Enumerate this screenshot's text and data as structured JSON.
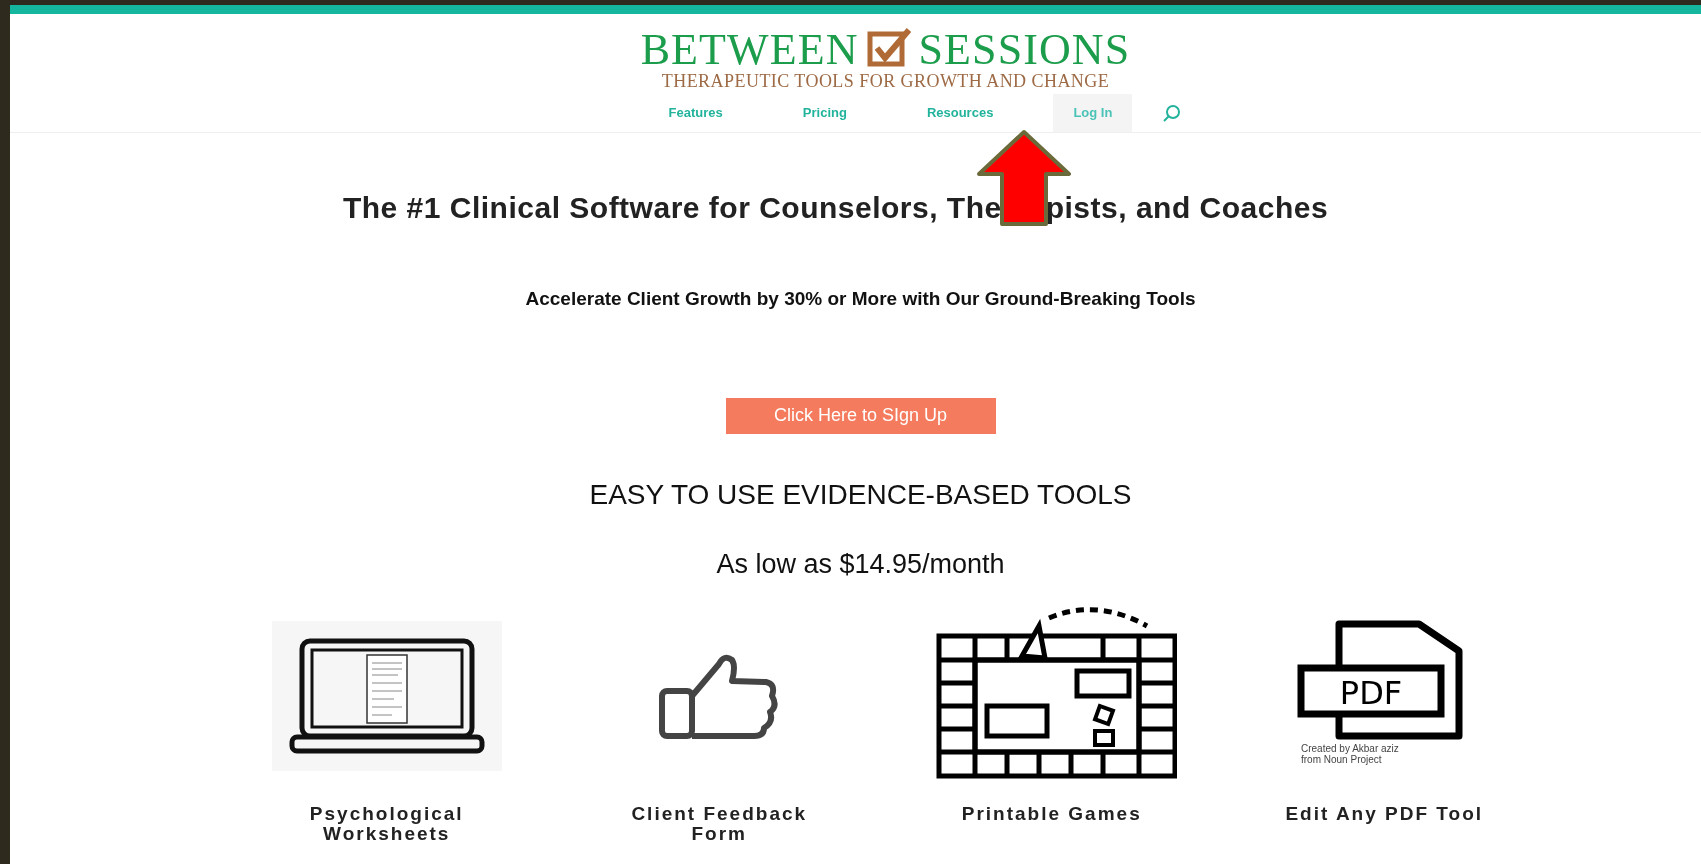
{
  "logo": {
    "left": "BETWEEN",
    "right": "SESSIONS",
    "tagline": "THERAPEUTIC TOOLS FOR GROWTH AND CHANGE"
  },
  "nav": [
    {
      "label": "Features",
      "selected": false
    },
    {
      "label": "Pricing",
      "selected": false
    },
    {
      "label": "Resources",
      "selected": false
    },
    {
      "label": "Log In",
      "selected": true
    }
  ],
  "headline": [
    "The #1 Clinical Software for Counselors, The",
    "pists, and Coaches"
  ],
  "subheadline": "Accelerate Client Growth by 30% or More with Our Ground-Breaking Tools",
  "signup_button": "Click Here to SIgn Up",
  "section_title": "EASY TO USE EVIDENCE-BASED TOOLS",
  "price": "As low as $14.95/month",
  "tools": [
    {
      "kind": "laptop",
      "label": "Psychological Worksheets"
    },
    {
      "kind": "thumb",
      "label": "Client Feedback Form"
    },
    {
      "kind": "board",
      "label": "Printable Games"
    },
    {
      "kind": "pdf",
      "label": "Edit Any PDF Tool",
      "icon_text": "PDF",
      "credit": [
        "Created by Akbar aziz",
        "from Noun Project"
      ]
    }
  ]
}
